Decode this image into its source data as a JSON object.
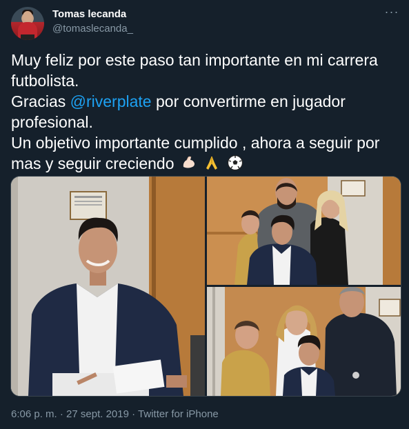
{
  "author": {
    "name": "Tomas lecanda",
    "handle": "@tomaslecanda_"
  },
  "menu": {
    "more_label": "···"
  },
  "tweet": {
    "line1": "Muy feliz por este paso tan importante en mi carrera",
    "line2": "futbolista.",
    "line3_before": "Gracias ",
    "line3_mention": "@riverplate",
    "line3_after": " por convertirme en jugador",
    "line4": "profesional.",
    "line5": "Un objetivo importante cumplido , ahora a seguir por",
    "line6": "mas y seguir creciendo",
    "emojis": [
      "flexed-biceps",
      "folded-hands",
      "soccer-ball"
    ]
  },
  "media": {
    "photos": [
      {
        "description": "photo-signing-contract"
      },
      {
        "description": "photo-family-group-1"
      },
      {
        "description": "photo-family-group-2"
      }
    ]
  },
  "footer": {
    "time": "6:06 p. m.",
    "separator": " · ",
    "date": "27 sept. 2019",
    "source": "Twitter for iPhone"
  },
  "colors": {
    "background": "#15202b",
    "text": "#ffffff",
    "secondary": "#8899a6",
    "link": "#1da1f2",
    "border": "#38444d"
  }
}
